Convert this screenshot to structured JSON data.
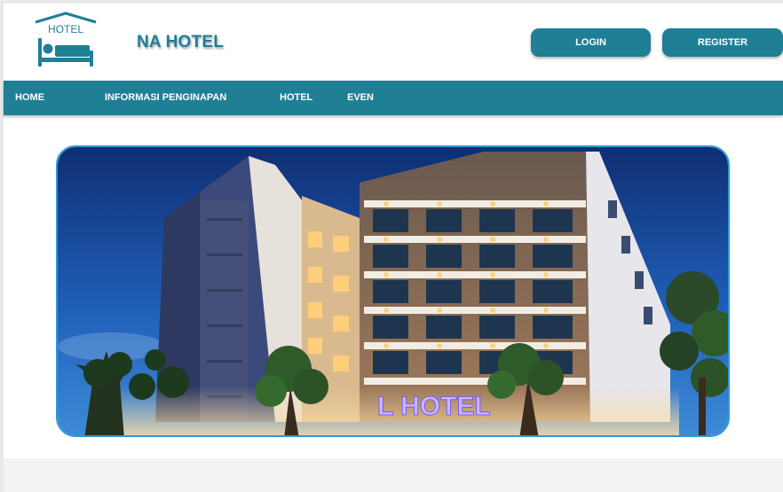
{
  "header": {
    "logo_text": "HOTEL",
    "brand": "NA HOTEL",
    "login_label": "LOGIN",
    "register_label": "REGISTER"
  },
  "nav": {
    "items": [
      "HOME",
      "INFORMASI PENGINAPAN",
      "HOTEL",
      "EVEN"
    ]
  },
  "hero": {
    "sign_text": "L HOTEL"
  },
  "colors": {
    "primary": "#1f7f95",
    "hero_border": "#2b9ad6",
    "sky_top": "#0f2e73",
    "sign": "#c9b6ff"
  },
  "icons": [
    "bed-icon",
    "hotel-roof-icon"
  ]
}
